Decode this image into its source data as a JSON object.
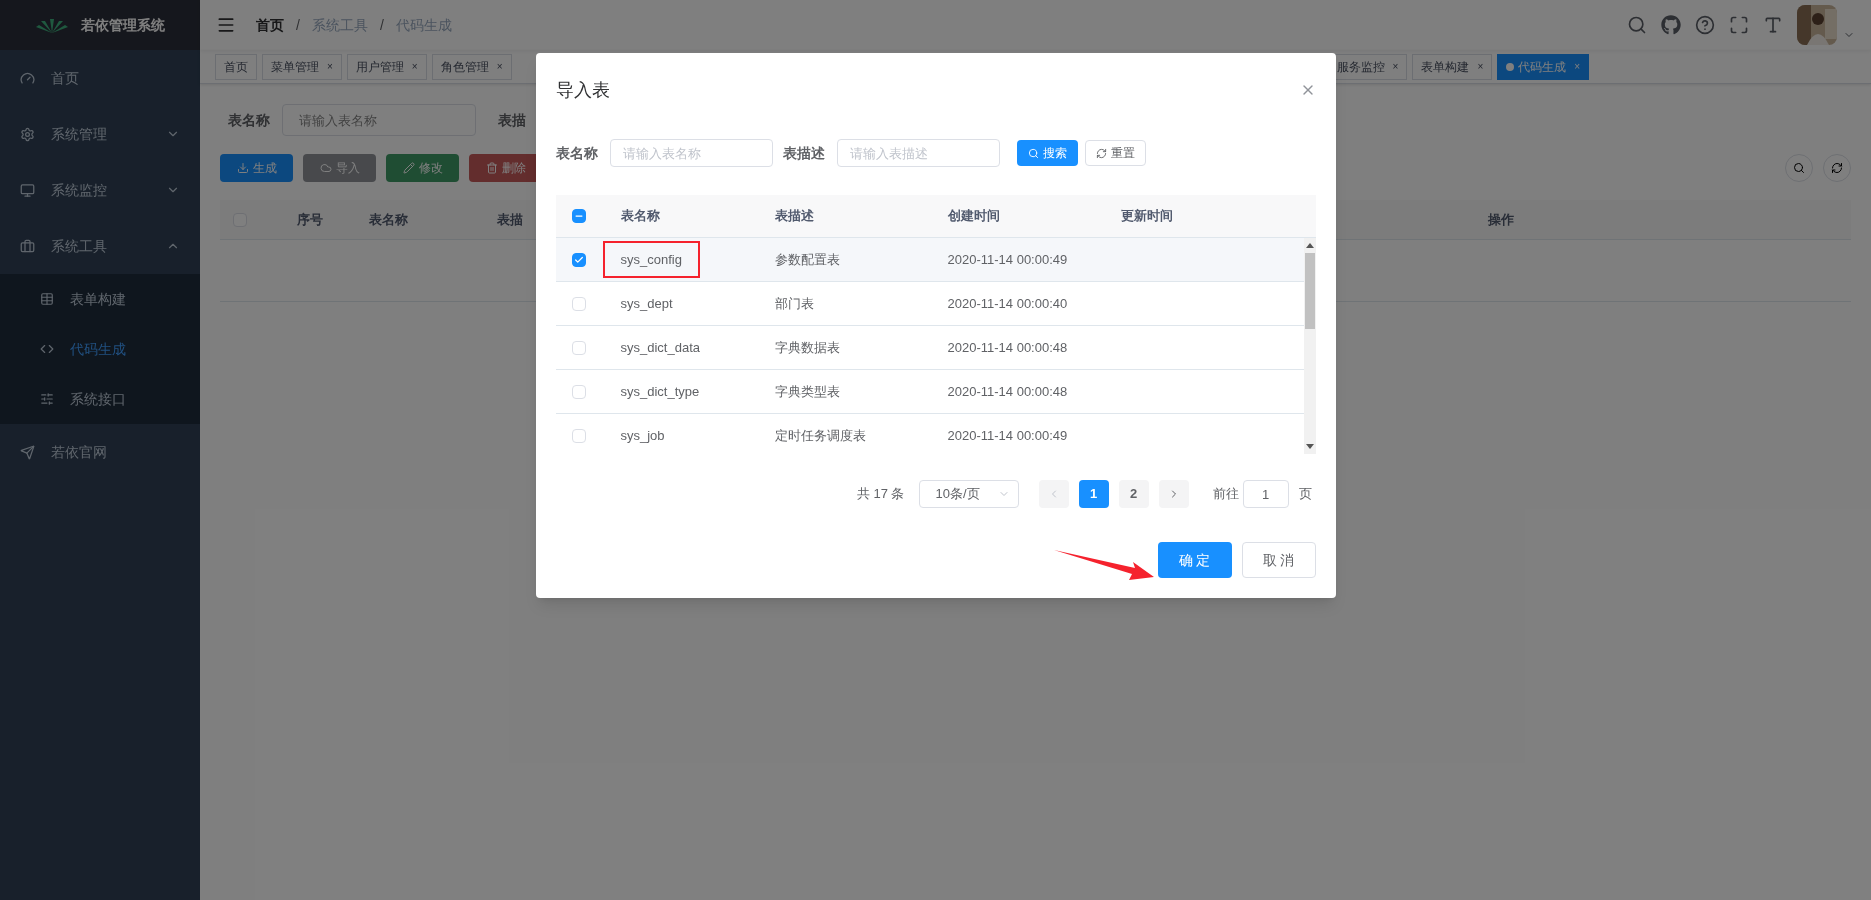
{
  "sidebar": {
    "title": "若依管理系统",
    "items": [
      {
        "label": "首页",
        "kind": "link"
      },
      {
        "label": "系统管理",
        "kind": "group",
        "expanded": false
      },
      {
        "label": "系统监控",
        "kind": "group",
        "expanded": false
      },
      {
        "label": "系统工具",
        "kind": "group",
        "expanded": true,
        "children": [
          {
            "label": "表单构建",
            "selected": false
          },
          {
            "label": "代码生成",
            "selected": true
          },
          {
            "label": "系统接口",
            "selected": false
          }
        ]
      },
      {
        "label": "若依官网",
        "kind": "link"
      }
    ]
  },
  "breadcrumb": {
    "separator": "/",
    "items": [
      "首页",
      "系统工具",
      "代码生成"
    ]
  },
  "tags_left": [
    {
      "label": "首页",
      "selected": false
    },
    {
      "label": "菜单管理",
      "selected": false,
      "close": "×"
    },
    {
      "label": "用户管理",
      "selected": false,
      "close": "×"
    },
    {
      "label": "角色管理",
      "selected": false,
      "close": "×"
    }
  ],
  "tags_right": [
    {
      "label": "服务监控",
      "selected": false,
      "close": "×"
    },
    {
      "label": "表单构建",
      "selected": false,
      "close": "×"
    },
    {
      "label": "代码生成",
      "selected": true,
      "close": "×"
    }
  ],
  "page": {
    "search": [
      {
        "label": "表名称",
        "placeholder": "请输入表名称"
      },
      {
        "label": "表描"
      }
    ],
    "buttons": [
      {
        "label": "生成",
        "kind": "primary",
        "disabled": false
      },
      {
        "label": "导入",
        "kind": "info",
        "disabled": false
      },
      {
        "label": "修改",
        "kind": "success",
        "disabled": true
      },
      {
        "label": "删除",
        "kind": "danger",
        "disabled": true
      }
    ],
    "header_checked": false,
    "columns": [
      "序号",
      "表名称",
      "表描"
    ],
    "actions_column": "操作"
  },
  "modal": {
    "title": "导入表",
    "search": [
      {
        "label": "表名称",
        "placeholder": "请输入表名称"
      },
      {
        "label": "表描述",
        "placeholder": "请输入表描述"
      }
    ],
    "search_buttons": [
      {
        "label": "搜索",
        "kind": "primary"
      },
      {
        "label": "重置",
        "kind": "default"
      }
    ],
    "header_indeterminate": true,
    "columns": [
      "表名称",
      "表描述",
      "创建时间",
      "更新时间"
    ],
    "rows": [
      {
        "name": "sys_config",
        "description": "参数配置表",
        "created": "2020-11-14 00:00:49",
        "checked": true,
        "highlighted": true
      },
      {
        "name": "sys_dept",
        "description": "部门表",
        "created": "2020-11-14 00:00:40",
        "checked": false,
        "highlighted": false
      },
      {
        "name": "sys_dict_data",
        "description": "字典数据表",
        "created": "2020-11-14 00:00:48",
        "checked": false,
        "highlighted": false
      },
      {
        "name": "sys_dict_type",
        "description": "字典类型表",
        "created": "2020-11-14 00:00:48",
        "checked": false,
        "highlighted": false
      },
      {
        "name": "sys_job",
        "description": "定时任务调度表",
        "created": "2020-11-14 00:00:49",
        "checked": false,
        "highlighted": false
      }
    ],
    "pagination": {
      "total": "共 17 条",
      "page_size": "10条/页",
      "pages": [
        {
          "label": "1",
          "selected": true
        },
        {
          "label": "2",
          "selected": false
        }
      ],
      "goto_label": "前往",
      "goto_value": "1",
      "page_suffix": "页"
    },
    "footer_buttons": [
      {
        "label": "确 定",
        "kind": "primary"
      },
      {
        "label": "取 消",
        "kind": "default"
      }
    ]
  }
}
